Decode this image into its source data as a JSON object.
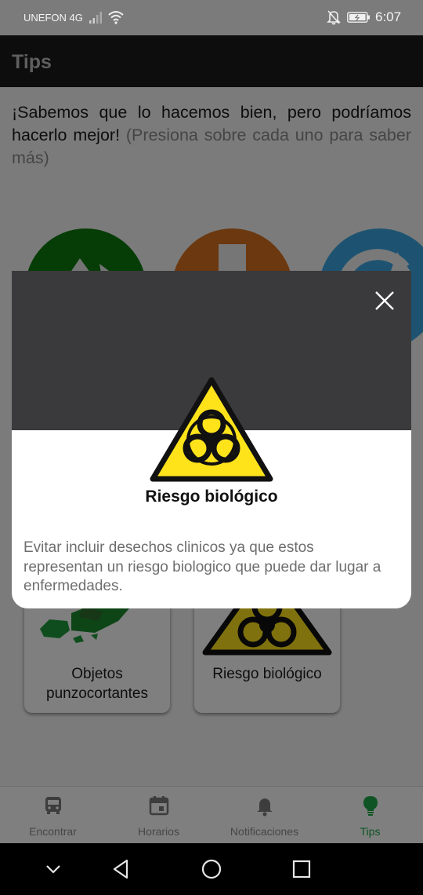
{
  "status_bar": {
    "carrier": "UNEFON 4G",
    "time": "6:07",
    "icons": [
      "signal-icon",
      "wifi-icon",
      "mute-icon",
      "battery-icon"
    ]
  },
  "app_bar": {
    "title": "Tips"
  },
  "intro": {
    "text": "¡Sabemos que lo hacemos bien, pero podríamos hacerlo mejor!",
    "hint": "(Presiona sobre cada uno para saber más)"
  },
  "tips_row": [
    {
      "icon": "recycle-icon",
      "color": "#0d7a0d"
    },
    {
      "icon": "tip-orange-icon",
      "color": "#d7711f"
    },
    {
      "icon": "reuse-icon",
      "color": "#3aa6e2"
    }
  ],
  "cards": [
    {
      "label": "Objetos punzocortantes",
      "icon": "broken-glass-icon"
    },
    {
      "label": "Riesgo biológico",
      "icon": "biohazard-icon"
    }
  ],
  "modal": {
    "title": "Riesgo biológico",
    "description": "Evitar incluir desechos clinicos ya que estos representan un riesgo biologico que puede dar lugar a enfermedades.",
    "icon": "biohazard-icon",
    "header_color": "#3a3a3c",
    "hazard_color": "#ffe31a"
  },
  "bottom_nav": [
    {
      "label": "Encontrar",
      "icon": "bus-icon",
      "active": false
    },
    {
      "label": "Horarios",
      "icon": "calendar-icon",
      "active": false
    },
    {
      "label": "Notificaciones",
      "icon": "bell-icon",
      "active": false
    },
    {
      "label": "Tips",
      "icon": "lightbulb-icon",
      "active": true
    }
  ],
  "accent_color": "#1fa848"
}
